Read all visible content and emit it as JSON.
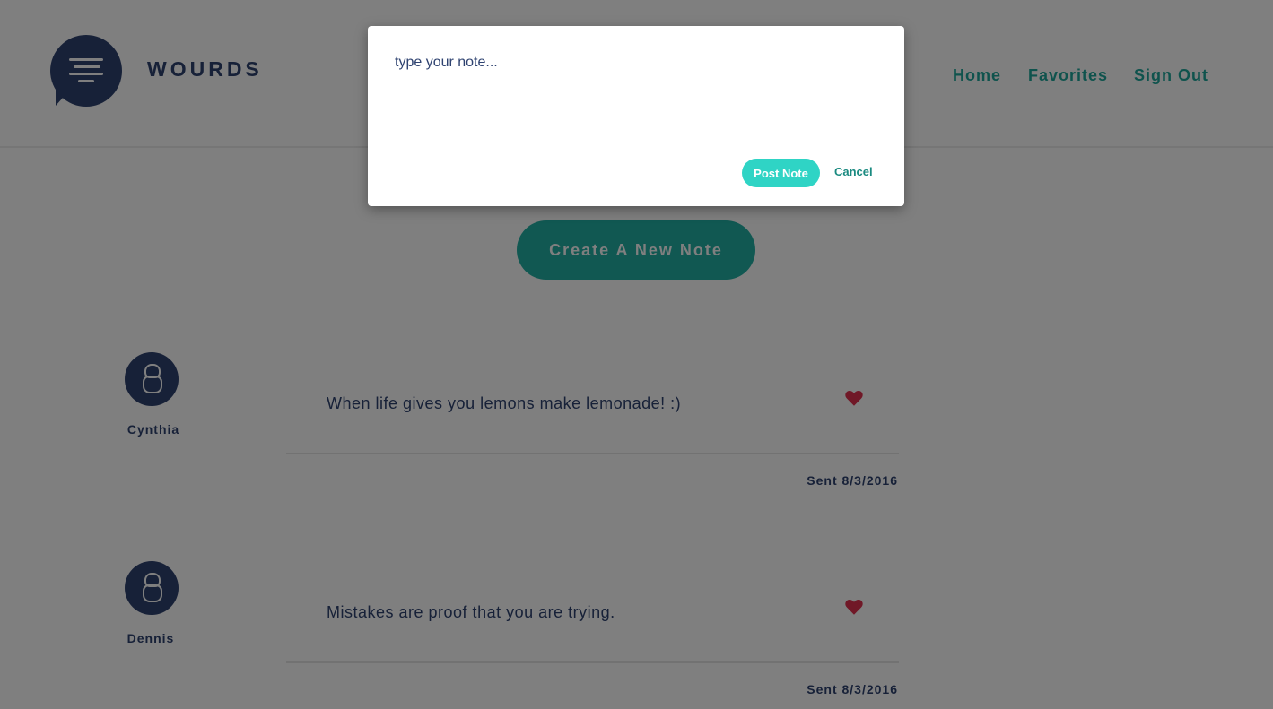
{
  "brand": {
    "name": "WOURDS",
    "logo_icon": "chat-bubble-lines-icon"
  },
  "nav": {
    "items": [
      {
        "label": "Home"
      },
      {
        "label": "Favorites"
      },
      {
        "label": "Sign Out"
      }
    ]
  },
  "main": {
    "create_label": "Create A New Note"
  },
  "notes": [
    {
      "author": "Cynthia",
      "text": "When life gives you lemons make lemonade! :)",
      "sent": "Sent 8/3/2016",
      "favorite_icon": "heart-icon"
    },
    {
      "author": "Dennis",
      "text": "Mistakes are proof that you are trying.",
      "sent": "Sent 8/3/2016",
      "favorite_icon": "heart-icon"
    }
  ],
  "modal": {
    "placeholder": "type your note...",
    "value": "",
    "post_label": "Post Note",
    "cancel_label": "Cancel"
  },
  "colors": {
    "brand_navy": "#2e4270",
    "accent_teal": "#22b0a4",
    "post_button": "#2fd4c5",
    "heart_red": "#e0304e"
  }
}
